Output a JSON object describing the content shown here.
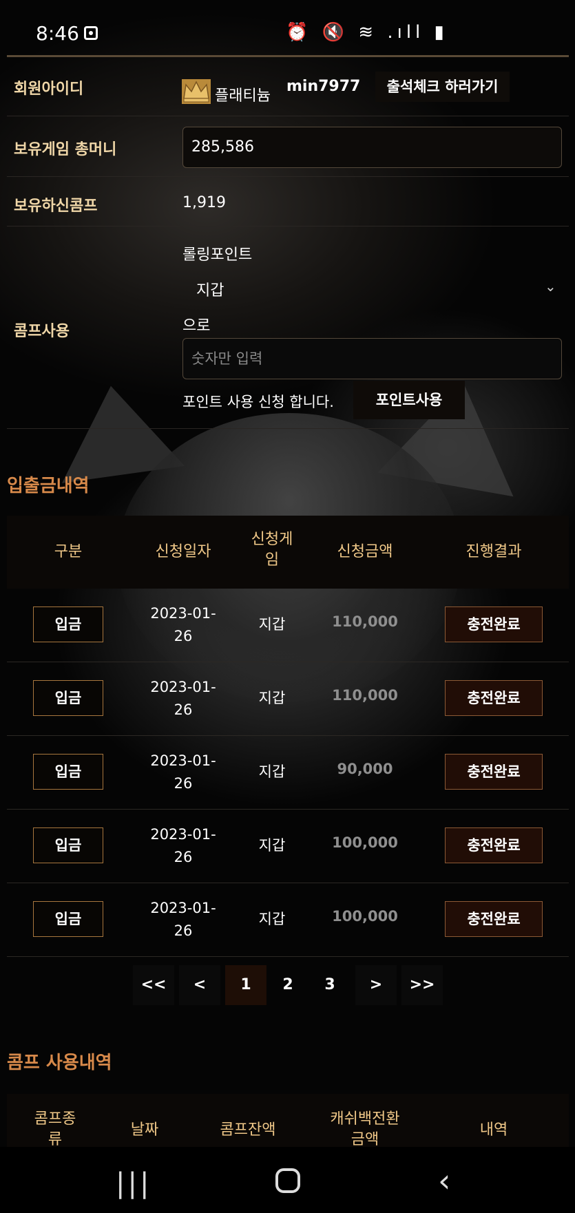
{
  "status_bar": {
    "time": "8:46",
    "icons": "⏰ 🔇 ≋ .ıll ▮"
  },
  "member": {
    "id_label": "회원아이디",
    "grade": "플래티늄",
    "user_id": "min7977",
    "attendance_button": "출석체크 하러가기",
    "money_label": "보유게임 총머니",
    "money_value": "285,586",
    "comp_label": "보유하신콤프",
    "comp_value": "1,919",
    "comp_use_label": "콤프사용",
    "rolling_label": "롤링포인트",
    "wallet_option": "지갑",
    "euro_label": "으로",
    "point_input_placeholder": "숫자만 입력",
    "point_text": "포인트 사용 신청 합니다.",
    "point_button": "포인트사용"
  },
  "deposit_history": {
    "title": "입출금내역",
    "headers": [
      "구분",
      "신청일자",
      "신청게\n임",
      "신청금액",
      "진행결과"
    ],
    "rows": [
      {
        "type": "입금",
        "date_line1": "2023-01-",
        "date_line2": "26",
        "game": "지갑",
        "amount": "110,000",
        "result": "충전완료"
      },
      {
        "type": "입금",
        "date_line1": "2023-01-",
        "date_line2": "26",
        "game": "지갑",
        "amount": "110,000",
        "result": "충전완료"
      },
      {
        "type": "입금",
        "date_line1": "2023-01-",
        "date_line2": "26",
        "game": "지갑",
        "amount": "90,000",
        "result": "충전완료"
      },
      {
        "type": "입금",
        "date_line1": "2023-01-",
        "date_line2": "26",
        "game": "지갑",
        "amount": "100,000",
        "result": "충전완료"
      },
      {
        "type": "입금",
        "date_line1": "2023-01-",
        "date_line2": "26",
        "game": "지갑",
        "amount": "100,000",
        "result": "충전완료"
      }
    ]
  },
  "pagination": {
    "first": "<<",
    "prev": "<",
    "pages": [
      "1",
      "2",
      "3"
    ],
    "current": "1",
    "next": ">",
    "last": ">>"
  },
  "comp_history": {
    "title": "콤프 사용내역",
    "headers": [
      "콤프종\n류",
      "날짜",
      "콤프잔액",
      "캐쉬백전환\n금액",
      "내역"
    ]
  },
  "colors": {
    "accent_orange": "#d7894a",
    "label_gold": "#f0d7a8",
    "header_gold": "#f0c888"
  }
}
